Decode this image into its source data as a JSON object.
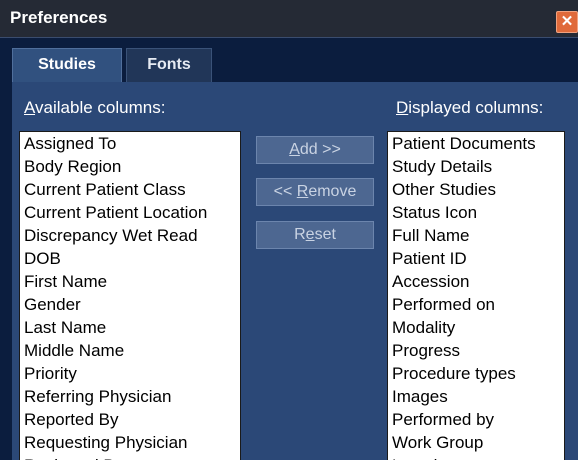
{
  "window": {
    "title": "Preferences",
    "close_glyph": "✕"
  },
  "tabs": [
    {
      "label": "Studies",
      "active": true
    },
    {
      "label": "Fonts",
      "active": false
    }
  ],
  "available": {
    "heading_accel": "A",
    "heading_rest": "vailable columns:",
    "items": [
      "Assigned To",
      "Body Region",
      "Current Patient Class",
      "Current Patient Location",
      "Discrepancy Wet Read",
      "DOB",
      "First Name",
      "Gender",
      "Last Name",
      "Middle Name",
      "Priority",
      "Referring Physician",
      "Reported By",
      "Requesting Physician",
      "Reviewed By"
    ]
  },
  "displayed": {
    "heading_accel": "D",
    "heading_rest": "isplayed columns:",
    "items": [
      "Patient Documents",
      "Study Details",
      "Other Studies",
      "Status Icon",
      "Full Name",
      "Patient ID",
      "Accession",
      "Performed on",
      "Modality",
      "Progress",
      "Procedure types",
      "Images",
      "Performed by",
      "Work Group",
      "Location"
    ]
  },
  "buttons": {
    "add": {
      "accel": "A",
      "rest": "dd >>"
    },
    "remove": {
      "prefix": "<< ",
      "accel": "R",
      "rest": "emove"
    },
    "reset": {
      "pre": "R",
      "accel": "e",
      "rest": "set"
    }
  },
  "colors": {
    "dialog_bg": "#0b1d3e",
    "panel_bg": "#2b4877",
    "titlebar_bg": "#252a35",
    "close_button": "#e06a3a",
    "button_bg": "#4d6791"
  }
}
